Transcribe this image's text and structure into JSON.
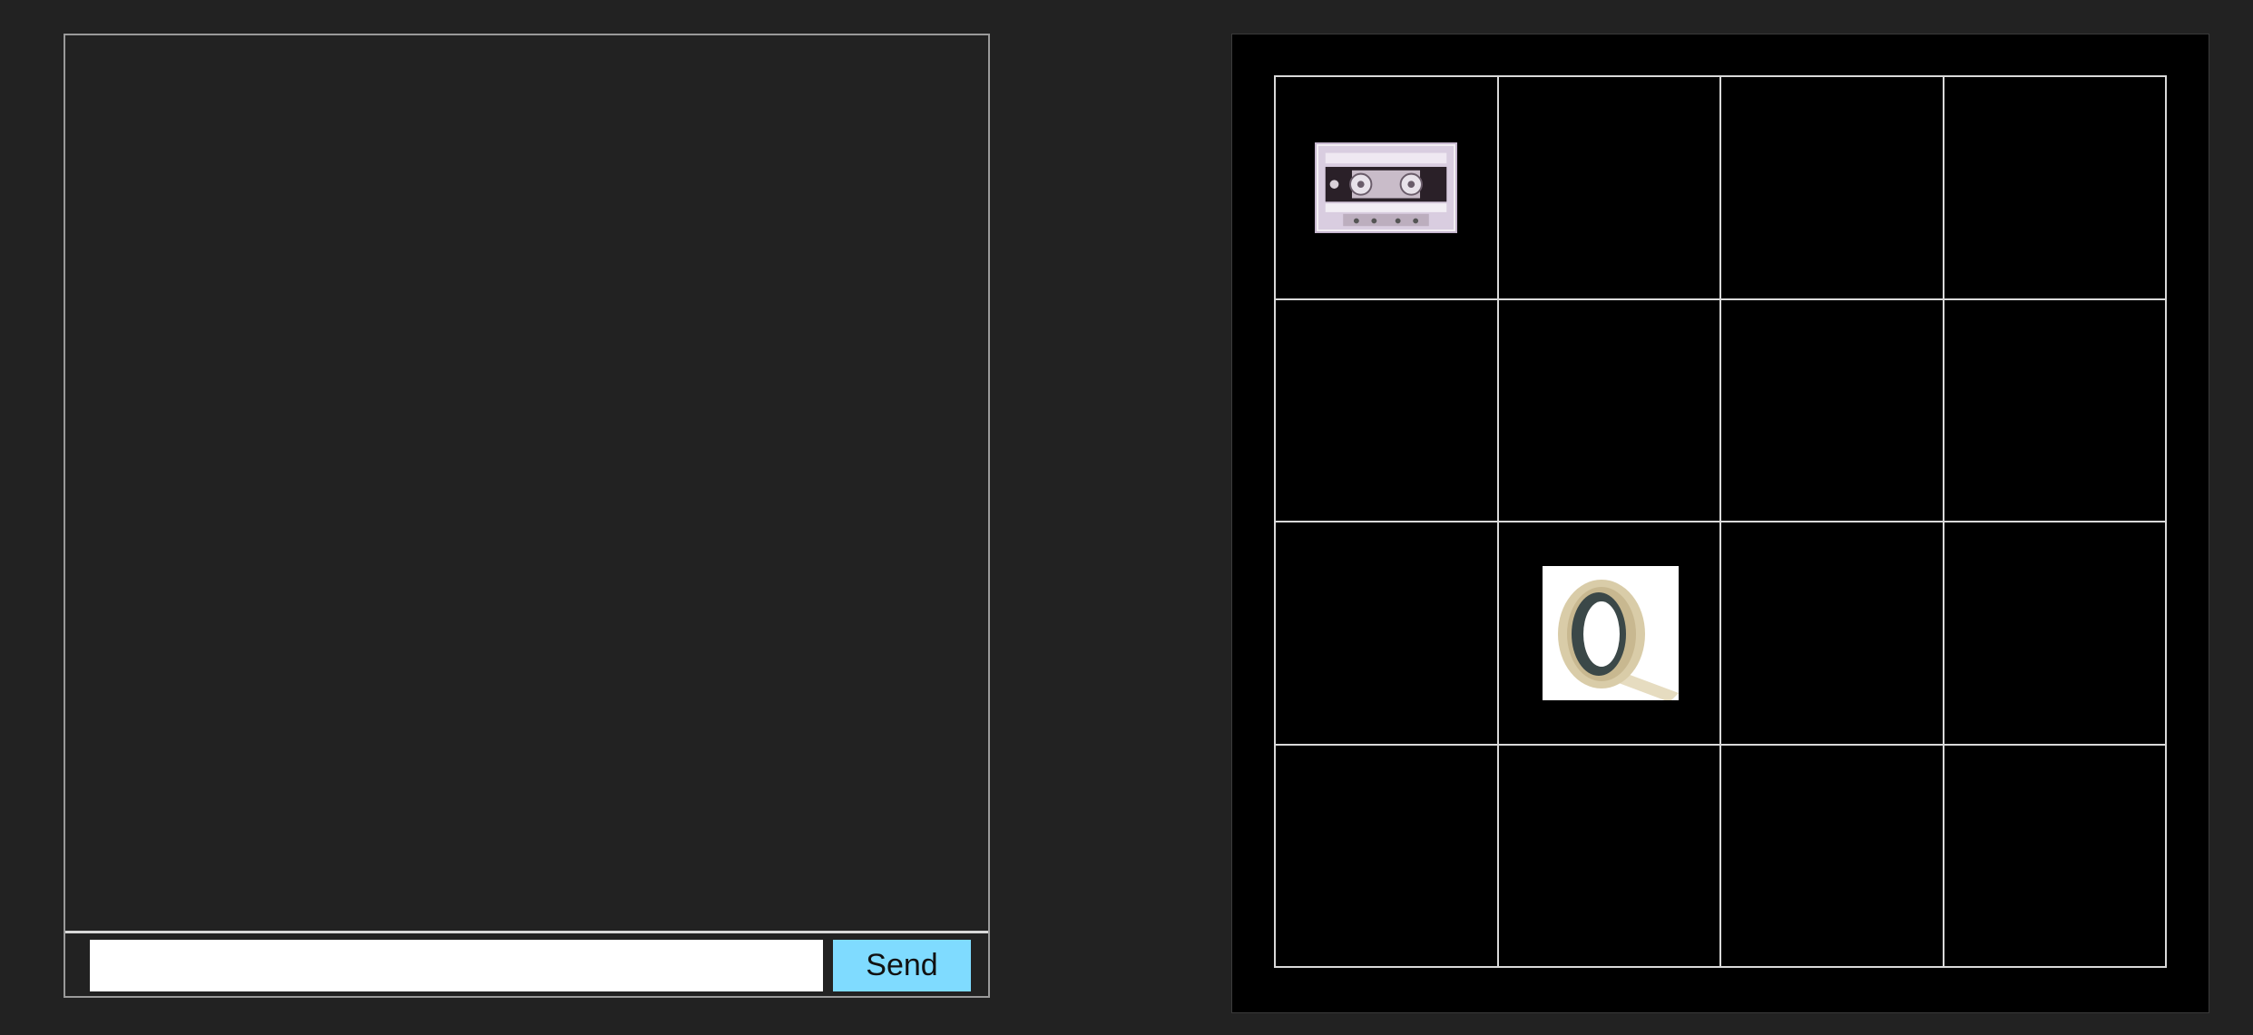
{
  "chat": {
    "messages": [],
    "input_value": "",
    "input_placeholder": "",
    "send_label": "Send"
  },
  "board": {
    "rows": 4,
    "columns": 4,
    "items": [
      {
        "name": "cassette-tape",
        "row": 1,
        "column": 1
      },
      {
        "name": "masking-tape-roll",
        "row": 3,
        "column": 2
      }
    ]
  },
  "colors": {
    "page_background": "#222222",
    "board_background": "#000000",
    "grid_lines": "#d9d9d9",
    "send_button": "#7fdbff"
  }
}
